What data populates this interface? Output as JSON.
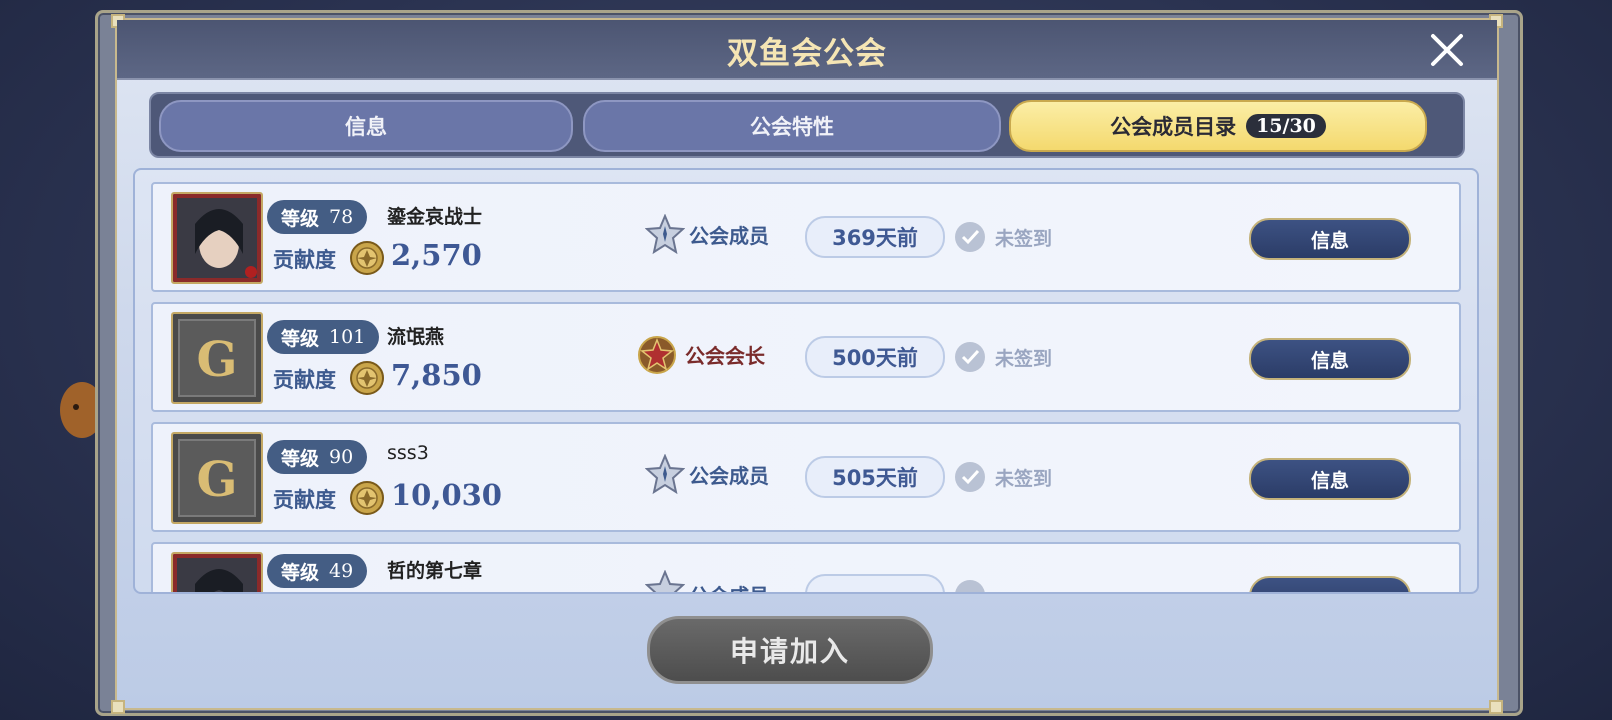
{
  "title": "双鱼会公会",
  "tabs": [
    {
      "label": "信息",
      "active": false
    },
    {
      "label": "公会特性",
      "active": false
    },
    {
      "label": "公会成员目录",
      "active": true,
      "count": "15/30"
    }
  ],
  "members": [
    {
      "level_label": "等级",
      "level": "78",
      "name": "鎏金哀战士",
      "contrib_label": "贡献度",
      "contrib": "2,570",
      "role": "公会成员",
      "last_seen": "369天前",
      "checkin": "未签到",
      "button": "信息",
      "avatar": "character-portrait",
      "role_icon": "member-star-icon"
    },
    {
      "level_label": "等级",
      "level": "101",
      "name": "流氓燕",
      "contrib_label": "贡献度",
      "contrib": "7,850",
      "role": "公会会长",
      "last_seen": "500天前",
      "checkin": "未签到",
      "button": "信息",
      "avatar": "default-g-emblem",
      "role_icon": "leader-star-icon"
    },
    {
      "level_label": "等级",
      "level": "90",
      "name": "sss3",
      "contrib_label": "贡献度",
      "contrib": "10,030",
      "role": "公会成员",
      "last_seen": "505天前",
      "checkin": "未签到",
      "button": "信息",
      "avatar": "default-g-emblem",
      "role_icon": "member-star-icon"
    },
    {
      "level_label": "等级",
      "level": "49",
      "name": "哲的第七章",
      "contrib_label": "",
      "contrib": "",
      "role": "公会成员",
      "last_seen": "",
      "checkin": "",
      "button": "",
      "avatar": "character-portrait",
      "role_icon": "member-star-icon"
    }
  ],
  "apply_button": "申请加入",
  "colors": {
    "leader_role": "#7a2b2b",
    "member_role": "#3d5a8e",
    "accent_gold": "#f4d96e"
  }
}
